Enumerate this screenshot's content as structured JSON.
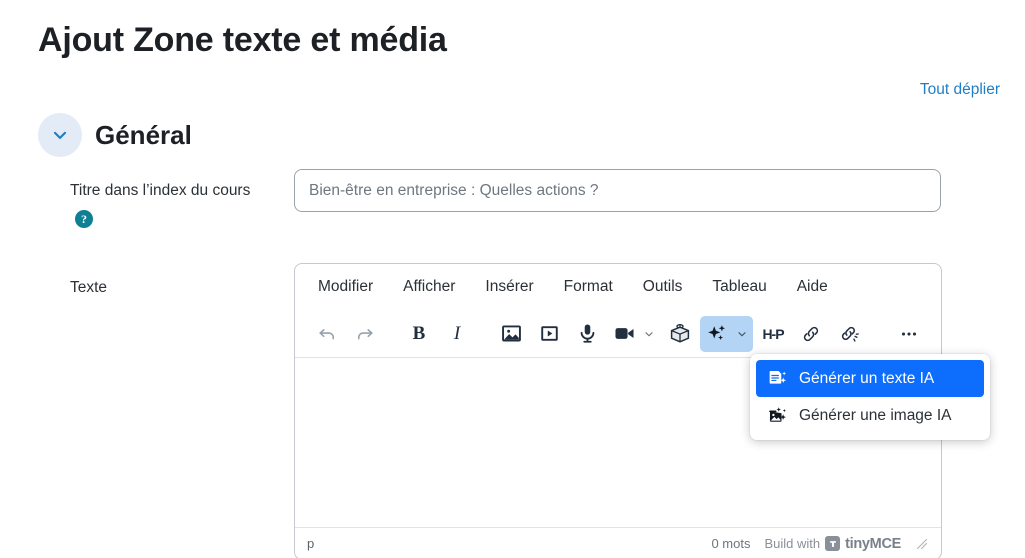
{
  "page": {
    "title": "Ajout Zone texte et média",
    "expand_all_label": "Tout déplier"
  },
  "section": {
    "title": "Général",
    "collapse_icon": "chevron-down-icon"
  },
  "fields": {
    "course_index_title": {
      "label": "Titre dans l’index du cours",
      "help_glyph": "?",
      "help_icon": "help-circle-icon",
      "placeholder": "Bien-être en entreprise : Quelles actions ?",
      "value": ""
    },
    "text": {
      "label": "Texte"
    }
  },
  "editor": {
    "menubar": [
      {
        "label": "Modifier",
        "name": "menu-modifier"
      },
      {
        "label": "Afficher",
        "name": "menu-afficher"
      },
      {
        "label": "Insérer",
        "name": "menu-inserer"
      },
      {
        "label": "Format",
        "name": "menu-format"
      },
      {
        "label": "Outils",
        "name": "menu-outils"
      },
      {
        "label": "Tableau",
        "name": "menu-tableau"
      },
      {
        "label": "Aide",
        "name": "menu-aide"
      }
    ],
    "toolbar": [
      {
        "icon": "undo-icon",
        "label": "Annuler",
        "state": "disabled"
      },
      {
        "icon": "redo-icon",
        "label": "Rétablir",
        "state": "disabled"
      },
      {
        "icon": "bold-icon",
        "label": "Gras",
        "glyph": "B"
      },
      {
        "icon": "italic-icon",
        "label": "Italique",
        "glyph": "I"
      },
      {
        "icon": "image-icon",
        "label": "Image"
      },
      {
        "icon": "video-frame-icon",
        "label": "Média"
      },
      {
        "icon": "microphone-icon",
        "label": "Enregistrer audio"
      },
      {
        "icon": "video-camera-icon",
        "label": "Enregistrer vidéo",
        "has_caret": true
      },
      {
        "icon": "lego-brick-icon",
        "label": "H5P contenu"
      },
      {
        "icon": "ai-sparkles-icon",
        "label": "IA",
        "has_caret": true,
        "state": "active"
      },
      {
        "icon": "h5p-icon",
        "label": "H5P",
        "glyph": "H-P"
      },
      {
        "icon": "link-icon",
        "label": "Lien"
      },
      {
        "icon": "unlink-icon",
        "label": "Supprimer le lien"
      },
      {
        "icon": "more-dots-icon",
        "label": "Plus"
      }
    ],
    "ai_menu": [
      {
        "icon": "ai-text-icon",
        "label": "Générer un texte IA",
        "selected": true
      },
      {
        "icon": "ai-image-icon",
        "label": "Générer une image IA",
        "selected": false
      }
    ],
    "content": "",
    "statusbar": {
      "element_path": "p",
      "word_count": "0 mots",
      "build_with": "Build with",
      "brand": "tinyMCE",
      "resize_icon": "resize-grip-icon"
    }
  },
  "colors": {
    "accent_blue": "#0d6efd",
    "link_blue": "#1f7ec4",
    "help_teal": "#0f7f94",
    "active_toolbar_bg": "#b4d4f6",
    "icon_dark": "#222f3e",
    "disabled_icon": "#96a1ab"
  }
}
